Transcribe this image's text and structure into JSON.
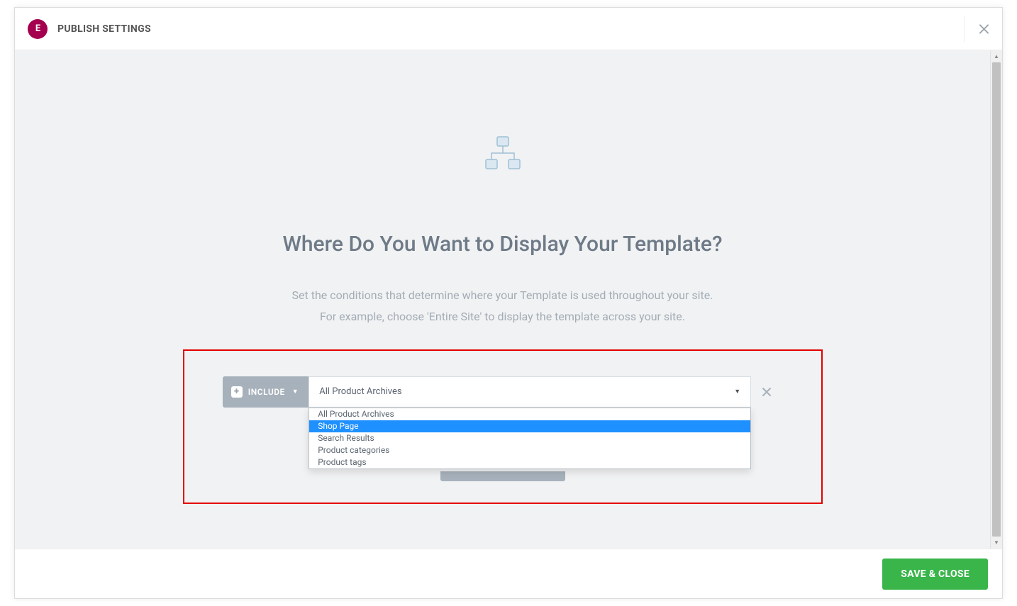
{
  "header": {
    "logo_text": "E",
    "title": "PUBLISH SETTINGS"
  },
  "content": {
    "heading": "Where Do You Want to Display Your Template?",
    "desc_line1": "Set the conditions that determine where your Template is used throughout your site.",
    "desc_line2": "For example, choose 'Entire Site' to display the template across your site."
  },
  "condition": {
    "include_label": "INCLUDE",
    "select_value": "All Product Archives",
    "options": [
      {
        "label": "All Product Archives",
        "selected": false
      },
      {
        "label": "Shop Page",
        "selected": true
      },
      {
        "label": "Search Results",
        "selected": false
      },
      {
        "label": "Product categories",
        "selected": false
      },
      {
        "label": "Product tags",
        "selected": false
      }
    ]
  },
  "footer": {
    "save_label": "SAVE & CLOSE"
  }
}
